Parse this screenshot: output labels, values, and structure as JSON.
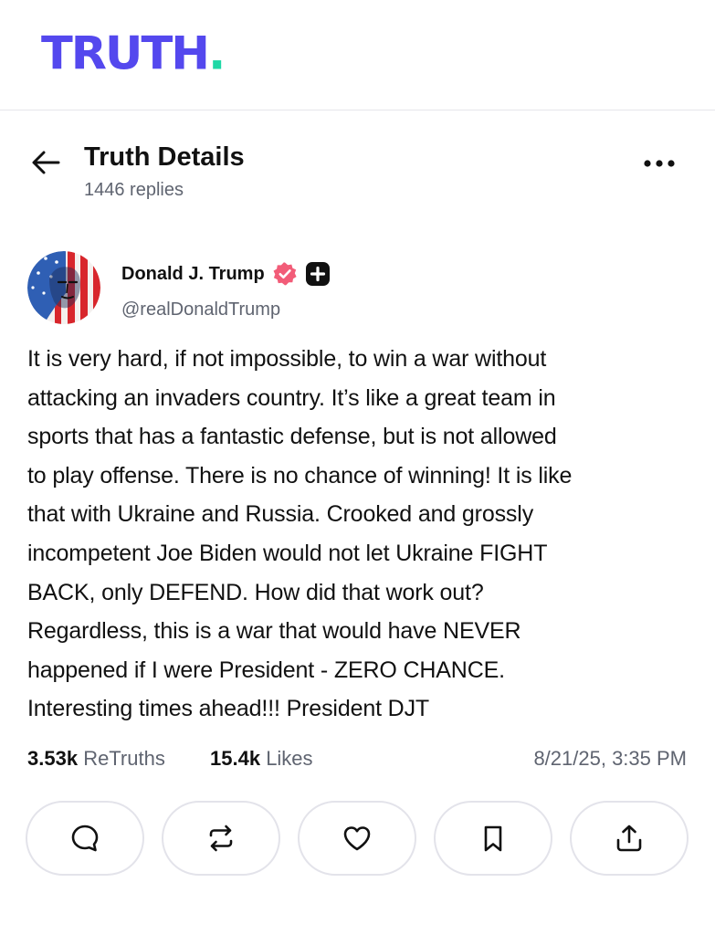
{
  "brand": {
    "logo_text": "TRUTH",
    "logo_dot": ".",
    "logo_color": "#5448ee",
    "dot_color": "#1fd8a6"
  },
  "header": {
    "back_icon": "arrow-left-icon",
    "title": "Truth Details",
    "subtitle": "1446 replies",
    "more_icon": "more-horizontal-icon"
  },
  "author": {
    "name": "Donald J. Trump",
    "handle": "@realDonaldTrump",
    "verified_icon": "verified-badge-icon",
    "verified_color": "#f25c78",
    "plus_icon": "truth-plus-icon"
  },
  "post": {
    "text": "It is very hard, if not impossible, to win a war without\nattacking an invaders country. It’s like a great team in\nsports that has a fantastic defense, but is not allowed\nto play offense. There is no chance of winning! It is like\nthat with Ukraine and Russia. Crooked and grossly\nincompetent Joe Biden would not let Ukraine FIGHT\nBACK, only DEFEND. How did that work out?\nRegardless, this is a war that would have NEVER\nhappened if I were President - ZERO CHANCE.\nInteresting times ahead!!! President DJT"
  },
  "stats": {
    "retruths_count": "3.53k",
    "retruths_label": "ReTruths",
    "likes_count": "15.4k",
    "likes_label": "Likes",
    "timestamp": "8/21/25, 3:35 PM"
  },
  "actions": [
    {
      "icon": "reply-icon"
    },
    {
      "icon": "retruth-icon"
    },
    {
      "icon": "like-icon"
    },
    {
      "icon": "bookmark-icon"
    },
    {
      "icon": "share-icon"
    }
  ]
}
